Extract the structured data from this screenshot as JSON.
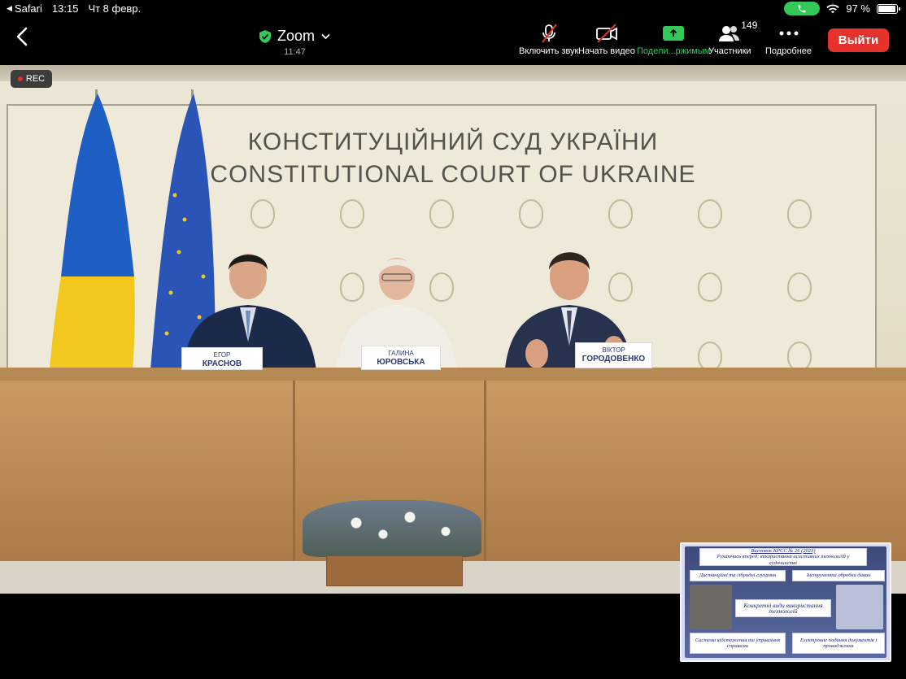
{
  "status_bar": {
    "back_app": "Safari",
    "time": "13:15",
    "date": "Чт 8 февр.",
    "battery_percent": "97 %",
    "battery_level": 0.97
  },
  "toolbar": {
    "title": "Zoom",
    "meeting_timer": "11:47",
    "mute_label": "Включить звук",
    "video_label": "Начать видео",
    "share_label": "Подели...ржимым",
    "participants_label": "Участники",
    "participants_count": "149",
    "more_label": "Подробнее",
    "leave_label": "Выйти"
  },
  "video": {
    "rec_label": "REC",
    "wall_title_ua": "КОНСТИТУЦІЙНИЙ СУД УКРАЇНИ",
    "wall_title_en": "CONSTITUTIONAL COURT OF UKRAINE",
    "nameplates": [
      {
        "first": "ЕГОР",
        "last": "КРАСНОВ"
      },
      {
        "first": "ГАЛИНА",
        "last": "ЮРОВСЬКА"
      },
      {
        "first": "ВІКТОР",
        "last": "ГОРОДОВЕНКО"
      }
    ]
  },
  "shared_slide": {
    "header_line1": "Висновок КРЄС № 26 (2023)",
    "header_line2": "Рухаючись вперед: використання асистивних технологій у судочинстві",
    "box_remote": "Дистанційні та гібридні слухання",
    "box_tools": "Інструменти обробки даних",
    "box_center": "Конкретні види використання технологій",
    "box_tracking": "Система відстеження та управління справами",
    "box_efiling": "Електронне подання документів і провадження"
  },
  "colors": {
    "leave": "#e5322d",
    "share": "#34c759",
    "call_pill": "#34c759",
    "slide_text": "#1a237e"
  }
}
